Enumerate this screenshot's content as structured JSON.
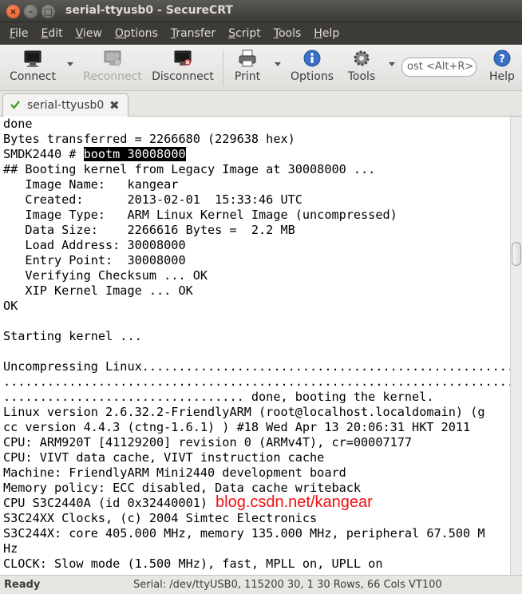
{
  "window": {
    "title": "serial-ttyusb0 - SecureCRT"
  },
  "menu": {
    "items": [
      {
        "key": "F",
        "rest": "ile"
      },
      {
        "key": "E",
        "rest": "dit"
      },
      {
        "key": "V",
        "rest": "iew"
      },
      {
        "key": "O",
        "rest": "ptions"
      },
      {
        "key": "T",
        "rest": "ransfer"
      },
      {
        "key": "S",
        "rest": "cript"
      },
      {
        "key": "T",
        "rest": "ools",
        "pre": ""
      },
      {
        "key": "H",
        "rest": "elp"
      }
    ]
  },
  "toolbar": {
    "connect": "Connect",
    "reconnect": "Reconnect",
    "disconnect": "Disconnect",
    "print": "Print",
    "options": "Options",
    "tools": "Tools",
    "search_text": "ost <Alt+R>",
    "help": "Help"
  },
  "tab": {
    "label": "serial-ttyusb0"
  },
  "terminal": {
    "lines": [
      "done",
      "Bytes transferred = 2266680 (229638 hex)",
      "SMDK2440 # ",
      "## Booting kernel from Legacy Image at 30008000 ...",
      "   Image Name:   kangear",
      "   Created:      2013-02-01  15:33:46 UTC",
      "   Image Type:   ARM Linux Kernel Image (uncompressed)",
      "   Data Size:    2266616 Bytes =  2.2 MB",
      "   Load Address: 30008000",
      "   Entry Point:  30008000",
      "   Verifying Checksum ... OK",
      "   XIP Kernel Image ... OK",
      "OK",
      "",
      "Starting kernel ...",
      "",
      "Uncompressing Linux.............................................................",
      "................................................................................",
      "................................. done, booting the kernel.",
      "Linux version 2.6.32.2-FriendlyARM (root@localhost.localdomain) (g",
      "cc version 4.4.3 (ctng-1.6.1) ) #18 Wed Apr 13 20:06:31 HKT 2011",
      "CPU: ARM920T [41129200] revision 0 (ARMv4T), cr=00007177",
      "CPU: VIVT data cache, VIVT instruction cache",
      "Machine: FriendlyARM Mini2440 development board",
      "Memory policy: ECC disabled, Data cache writeback",
      "CPU S3C2440A (id 0x32440001)",
      "S3C24XX Clocks, (c) 2004 Simtec Electronics",
      "S3C244X: core 405.000 MHz, memory 135.000 MHz, peripheral 67.500 M",
      "Hz",
      "CLOCK: Slow mode (1.500 MHz), fast, MPLL on, UPLL on"
    ],
    "highlighted_command": "bootm 30008000",
    "watermark": "blog.csdn.net/kangear"
  },
  "status": {
    "left": "Ready",
    "right": "Serial: /dev/ttyUSB0, 115200  30, 1  30 Rows, 66 Cols  VT100"
  },
  "colors": {
    "titlebar": "#3c3b37",
    "close_button": "#e25b26",
    "watermark": "#ee1111"
  }
}
